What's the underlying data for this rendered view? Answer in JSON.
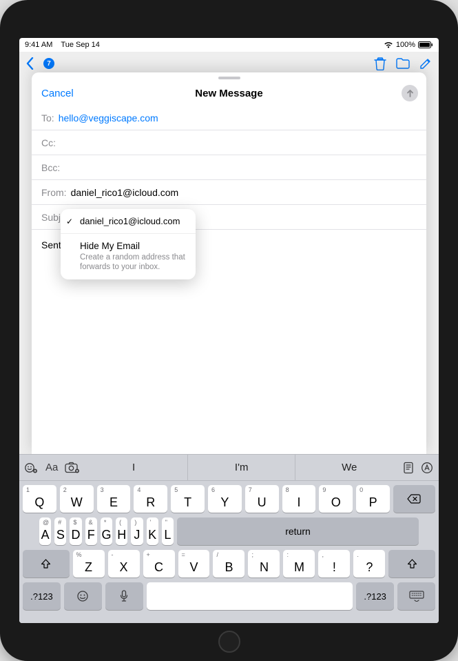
{
  "status": {
    "time": "9:41 AM",
    "date": "Tue Sep 14",
    "battery": "100%"
  },
  "mailnav": {
    "unread": "7"
  },
  "compose": {
    "cancel": "Cancel",
    "title": "New Message",
    "to_label": "To:",
    "to_value": "hello@veggiscape.com",
    "cc_label": "Cc:",
    "cc_value": "",
    "bcc_label": "Bcc:",
    "bcc_value": "",
    "from_label": "From:",
    "from_value": "daniel_rico1@icloud.com",
    "subject_label": "Subj",
    "subject_value": "",
    "body": "Sent"
  },
  "popover": {
    "selected": "daniel_rico1@icloud.com",
    "hide_title": "Hide My Email",
    "hide_sub": "Create a random address that forwards to your inbox."
  },
  "keyboard": {
    "preds": [
      "I",
      "I'm",
      "We"
    ],
    "row1": [
      {
        "k": "Q",
        "s": "1"
      },
      {
        "k": "W",
        "s": "2"
      },
      {
        "k": "E",
        "s": "3"
      },
      {
        "k": "R",
        "s": "4"
      },
      {
        "k": "T",
        "s": "5"
      },
      {
        "k": "Y",
        "s": "6"
      },
      {
        "k": "U",
        "s": "7"
      },
      {
        "k": "I",
        "s": "8"
      },
      {
        "k": "O",
        "s": "9"
      },
      {
        "k": "P",
        "s": "0"
      }
    ],
    "row2": [
      {
        "k": "A",
        "s": "@"
      },
      {
        "k": "S",
        "s": "#"
      },
      {
        "k": "D",
        "s": "$"
      },
      {
        "k": "F",
        "s": "&"
      },
      {
        "k": "G",
        "s": "*"
      },
      {
        "k": "H",
        "s": "("
      },
      {
        "k": "J",
        "s": ")"
      },
      {
        "k": "K",
        "s": "'"
      },
      {
        "k": "L",
        "s": "\""
      }
    ],
    "row3": [
      {
        "k": "Z",
        "s": "%"
      },
      {
        "k": "X",
        "s": "-"
      },
      {
        "k": "C",
        "s": "+"
      },
      {
        "k": "V",
        "s": "="
      },
      {
        "k": "B",
        "s": "/"
      },
      {
        "k": "N",
        "s": ";"
      },
      {
        "k": "M",
        "s": ":"
      },
      {
        "k": "!",
        "s": ","
      },
      {
        "k": "?",
        "s": "."
      }
    ],
    "return": "return",
    "sym": ".?123"
  }
}
